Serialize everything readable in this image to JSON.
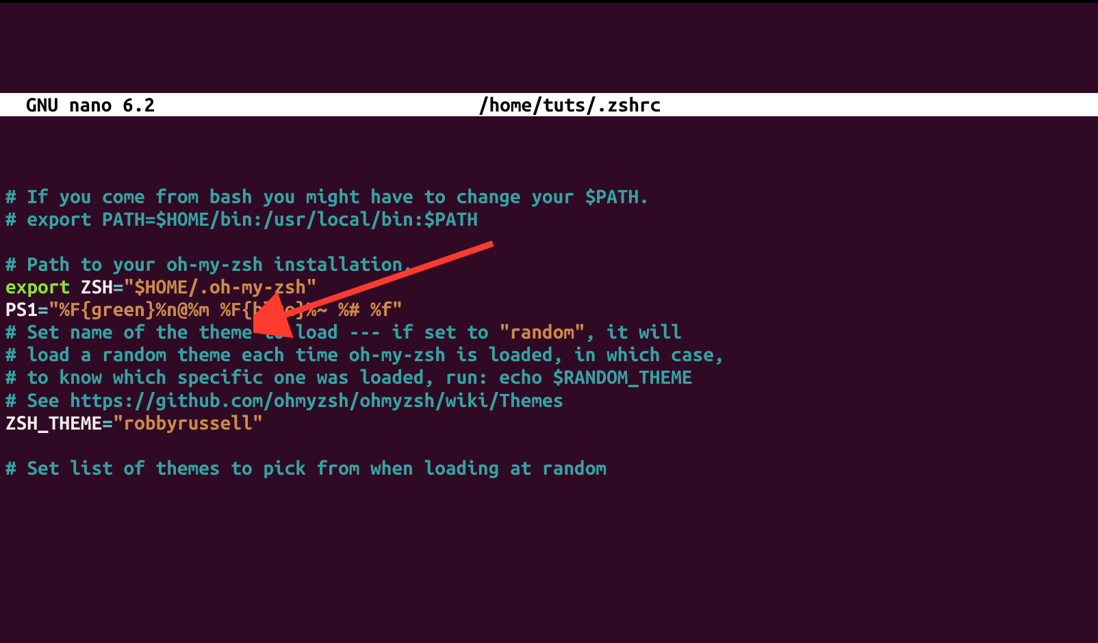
{
  "titlebar": {
    "app": "GNU nano 6.2",
    "file": "/home/tuts/.zshrc"
  },
  "code": {
    "l1": "# If you come from bash you might have to change your $PATH.",
    "l2": "# export PATH=$HOME/bin:/usr/local/bin:$PATH",
    "l3": "",
    "l4": "# Path to your oh-my-zsh installation.",
    "l5_kw": "export",
    "l5_sp": " ",
    "l5_var": "ZSH",
    "l5_eq": "=",
    "l5_str": "\"$HOME/.oh-my-zsh\"",
    "l6_var": "PS1",
    "l6_eq": "=",
    "l6_str": "\"%F{green}%n@%m %F{blue}%~ %# %f\"",
    "l7a": "# Set name of the theme to load --- if set to ",
    "l7b": "\"random\"",
    "l7c": ", it will",
    "l8": "# load a random theme each time oh-my-zsh is loaded, in which case,",
    "l9": "# to know which specific one was loaded, run: echo $RANDOM_THEME",
    "l10": "# See https://github.com/ohmyzsh/ohmyzsh/wiki/Themes",
    "l11_var": "ZSH_THEME",
    "l11_eq": "=",
    "l11_str": "\"robbyrussell\"",
    "l12": "",
    "l13": "# Set list of themes to pick from when loading at random"
  },
  "annotation": {
    "arrow_color": "#ff3b2f"
  }
}
